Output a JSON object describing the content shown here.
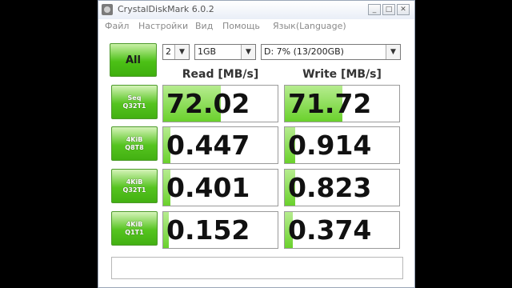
{
  "window": {
    "title": "CrystalDiskMark 6.0.2"
  },
  "menu": [
    "Файл",
    "Настройки",
    "Вид",
    "Помощь",
    "Язык(Language)"
  ],
  "controls": {
    "all_label": "All",
    "count_value": "2",
    "size_value": "1GB",
    "drive_value": "D: 7% (13/200GB)"
  },
  "columns": {
    "read": "Read [MB/s]",
    "write": "Write [MB/s]"
  },
  "tests": [
    {
      "line1": "Seq",
      "line2": "Q32T1",
      "read": "72.02",
      "write": "71.72",
      "read_fill": 0.5,
      "write_fill": 0.5
    },
    {
      "line1": "4KiB",
      "line2": "Q8T8",
      "read": "0.447",
      "write": "0.914",
      "read_fill": 0.06,
      "write_fill": 0.09
    },
    {
      "line1": "4KiB",
      "line2": "Q32T1",
      "read": "0.401",
      "write": "0.823",
      "read_fill": 0.06,
      "write_fill": 0.09
    },
    {
      "line1": "4KiB",
      "line2": "Q1T1",
      "read": "0.152",
      "write": "0.374",
      "read_fill": 0.05,
      "write_fill": 0.07
    }
  ],
  "colors": {
    "accent_green": "#4cc116",
    "bar_green": "#6ad12c"
  }
}
